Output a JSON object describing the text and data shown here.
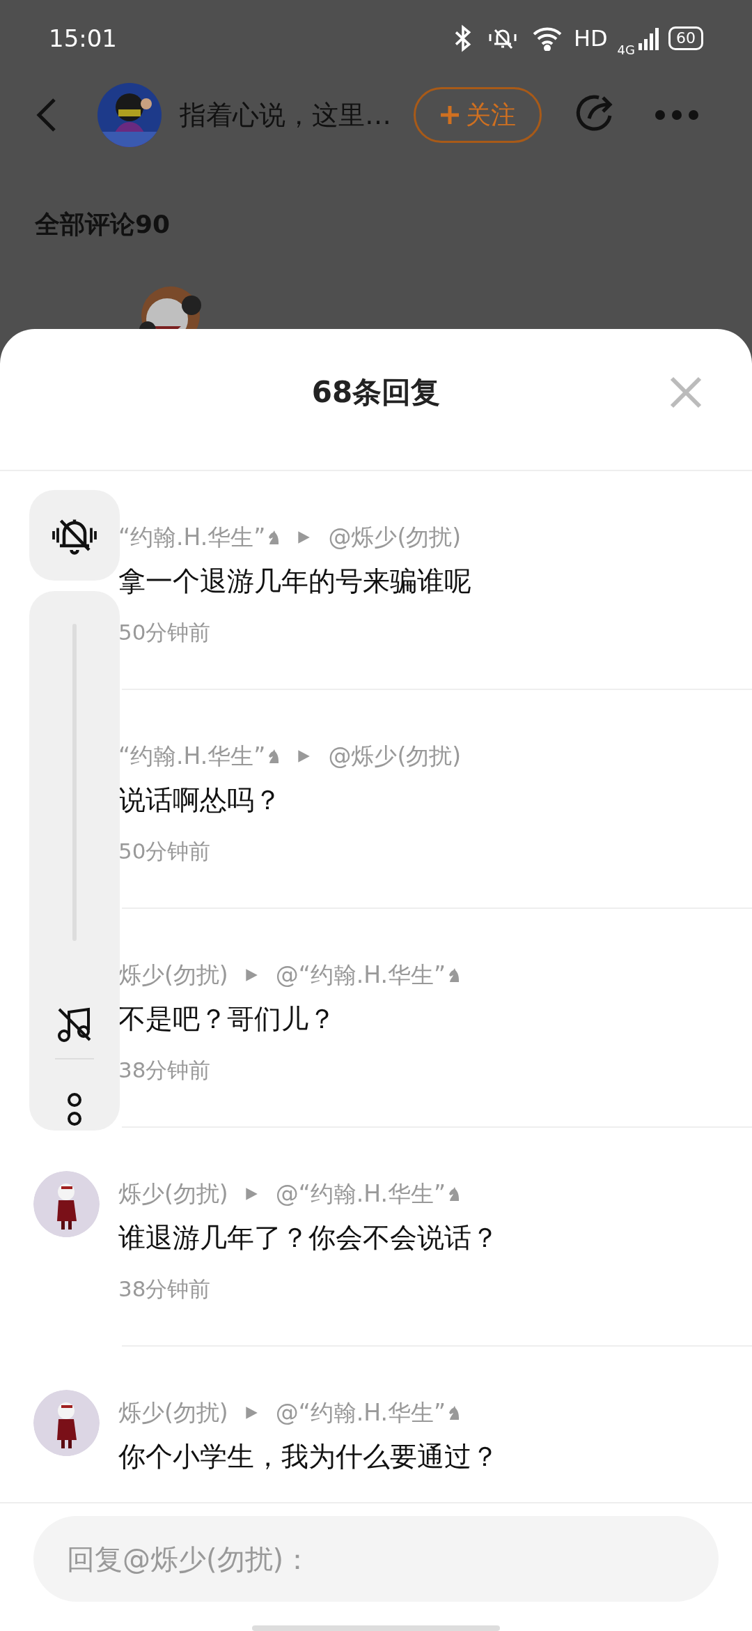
{
  "status_bar": {
    "time": "15:01",
    "network": "HD",
    "cellular": "4G",
    "battery": "60"
  },
  "nav": {
    "title": "指着心说，这里…",
    "follow_label": "关注"
  },
  "comments_header": "全部评论90",
  "sheet": {
    "title": "68条回复"
  },
  "replies": [
    {
      "avatar": false,
      "author": "“约翰.H.华生”",
      "author_badge": true,
      "target": "@烁少(勿扰)",
      "target_badge": false,
      "text": "拿一个退游几年的号来骗谁呢",
      "time": "50分钟前"
    },
    {
      "avatar": false,
      "author": "“约翰.H.华生”",
      "author_badge": true,
      "target": "@烁少(勿扰)",
      "target_badge": false,
      "text": "说话啊怂吗？",
      "time": "50分钟前"
    },
    {
      "avatar": false,
      "author": "烁少(勿扰)",
      "author_badge": false,
      "target": "@“约翰.H.华生”",
      "target_badge": true,
      "text": "不是吧？哥们儿？",
      "time": "38分钟前"
    },
    {
      "avatar": true,
      "author": "烁少(勿扰)",
      "author_badge": false,
      "target": "@“约翰.H.华生”",
      "target_badge": true,
      "text": "谁退游几年了？你会不会说话？",
      "time": "38分钟前"
    },
    {
      "avatar": true,
      "author": "烁少(勿扰)",
      "author_badge": false,
      "target": "@“约翰.H.华生”",
      "target_badge": true,
      "text": "你个小学生，我为什么要通过？"
    }
  ],
  "volume_panel": {
    "muted": true,
    "level": 0
  },
  "reply_box": {
    "placeholder": "回复@烁少(勿扰)："
  }
}
